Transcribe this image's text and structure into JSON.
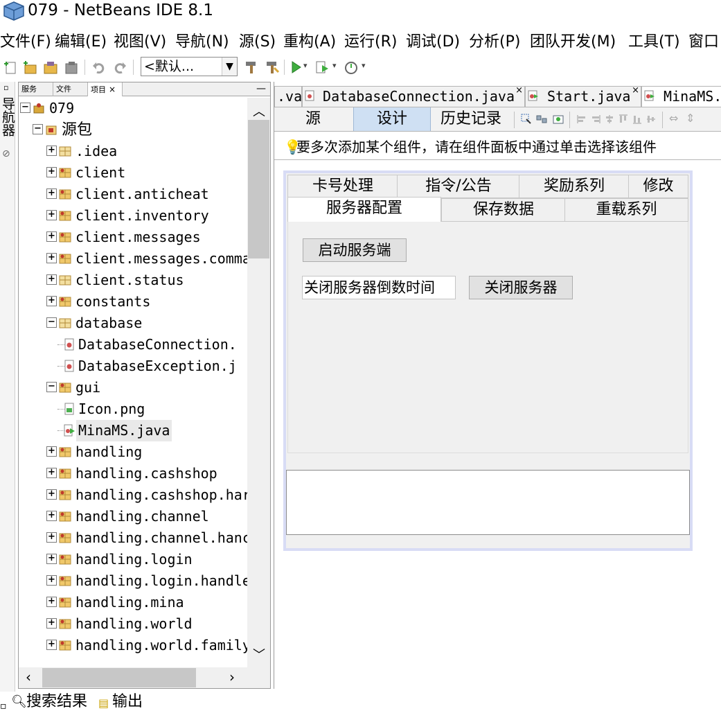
{
  "window": {
    "title": "079 - NetBeans IDE 8.1"
  },
  "menu": [
    "文件(F)",
    "编辑(E)",
    "视图(V)",
    "导航(N)",
    "源(S)",
    "重构(A)",
    "运行(R)",
    "调试(D)",
    "分析(P)",
    "团队开发(M)",
    "工具(T)",
    "窗口"
  ],
  "toolbar": {
    "config_value": "<默认...",
    "icons": [
      "new-file-icon",
      "new-project-icon",
      "open-project-icon",
      "close-project-icon",
      "undo-icon",
      "redo-icon",
      "build-icon",
      "clean-build-icon",
      "run-icon",
      "debug-icon",
      "profile-icon"
    ]
  },
  "left_strip": {
    "label": "导航器"
  },
  "panel": {
    "tabs": [
      "服务",
      "文件",
      "项目"
    ],
    "minimize": "—"
  },
  "tree": [
    {
      "label": "079",
      "toggle": "−",
      "icon": "project"
    },
    {
      "label": "源包",
      "toggle": "−",
      "icon": "source-root"
    },
    {
      "label": ".idea",
      "toggle": "+",
      "icon": "package-empty"
    },
    {
      "label": "client",
      "toggle": "+",
      "icon": "package"
    },
    {
      "label": "client.anticheat",
      "toggle": "+",
      "icon": "package"
    },
    {
      "label": "client.inventory",
      "toggle": "+",
      "icon": "package"
    },
    {
      "label": "client.messages",
      "toggle": "+",
      "icon": "package"
    },
    {
      "label": "client.messages.comma",
      "toggle": "+",
      "icon": "package"
    },
    {
      "label": "client.status",
      "toggle": "+",
      "icon": "package-empty"
    },
    {
      "label": "constants",
      "toggle": "+",
      "icon": "package"
    },
    {
      "label": "database",
      "toggle": "−",
      "icon": "package-empty"
    },
    {
      "label": "DatabaseConnection.",
      "toggle": "",
      "icon": "java-file"
    },
    {
      "label": "DatabaseException.j",
      "toggle": "",
      "icon": "java-file"
    },
    {
      "label": "gui",
      "toggle": "−",
      "icon": "package"
    },
    {
      "label": "Icon.png",
      "toggle": "",
      "icon": "image-file"
    },
    {
      "label": "MinaMS.java",
      "toggle": "",
      "icon": "form-file"
    },
    {
      "label": "handling",
      "toggle": "+",
      "icon": "package"
    },
    {
      "label": "handling.cashshop",
      "toggle": "+",
      "icon": "package"
    },
    {
      "label": "handling.cashshop.har",
      "toggle": "+",
      "icon": "package"
    },
    {
      "label": "handling.channel",
      "toggle": "+",
      "icon": "package"
    },
    {
      "label": "handling.channel.hanc",
      "toggle": "+",
      "icon": "package"
    },
    {
      "label": "handling.login",
      "toggle": "+",
      "icon": "package"
    },
    {
      "label": "handling.login.handle",
      "toggle": "+",
      "icon": "package"
    },
    {
      "label": "handling.mina",
      "toggle": "+",
      "icon": "package"
    },
    {
      "label": "handling.world",
      "toggle": "+",
      "icon": "package"
    },
    {
      "label": "handling.world.family",
      "toggle": "+",
      "icon": "package"
    }
  ],
  "editor": {
    "doc_tabs": [
      ".va",
      "DatabaseConnection.java",
      "Start.java",
      "MinaMS.j"
    ],
    "views": [
      "源",
      "设计",
      "历史记录"
    ],
    "hint": "要多次添加某个组件，请在组件面板中通过单击选择该组件"
  },
  "form": {
    "tabs_row1": [
      "卡号处理",
      "指令/公告",
      "奖励系列",
      "修改"
    ],
    "tabs_row2": [
      "服务器配置",
      "保存数据",
      "重载系列"
    ],
    "start_button": "启动服务端",
    "shutdown_time_field": "关闭服务器倒数时间",
    "shutdown_button": "关闭服务器"
  },
  "bottom": {
    "search_results": "搜索结果",
    "output": "输出"
  },
  "colors": {
    "selected_view": "#cfe0f3",
    "form_border": "#d8dcf5",
    "package_icon": "#d9a83a"
  }
}
